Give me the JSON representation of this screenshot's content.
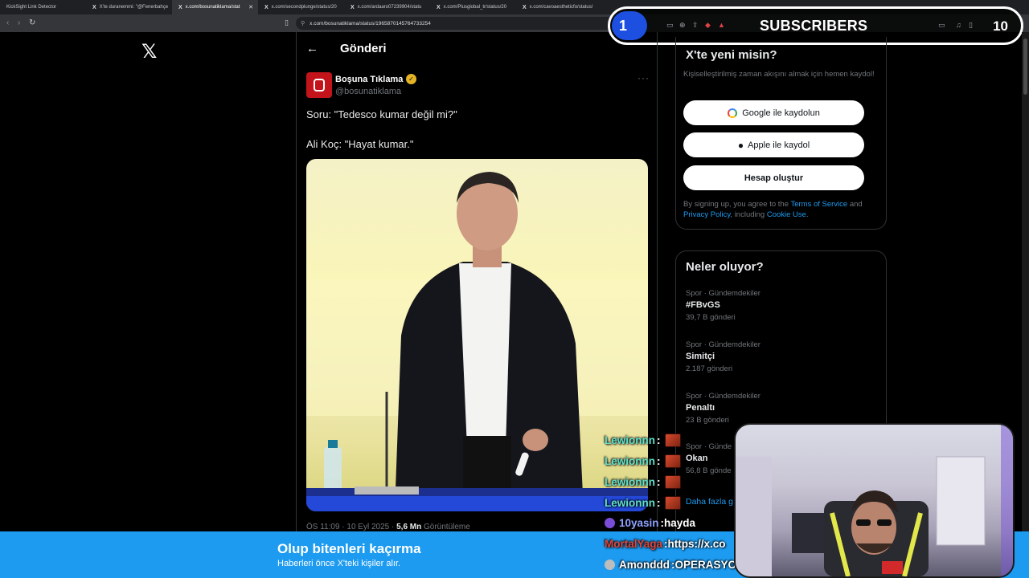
{
  "browser": {
    "tabs": [
      {
        "icon": "",
        "label": "KickSight Link Detector",
        "active": false
      },
      {
        "icon": "X",
        "label": "X'te duranemmi: \"@Fenerbahçe",
        "active": false
      },
      {
        "icon": "X",
        "label": "x.com/bosunatiklama/stat",
        "active": true
      },
      {
        "icon": "X",
        "label": "x.com/secondplunge/status/20",
        "active": false
      },
      {
        "icon": "X",
        "label": "x.com/ardaaro07239904/statu",
        "active": false
      },
      {
        "icon": "X",
        "label": "x.com/Plusglobal_tr/status/20",
        "active": false
      },
      {
        "icon": "X",
        "label": "x.com/cavoaestheticfo/status/",
        "active": false
      }
    ],
    "url": "x.com/bosunatiklama/status/1965870145764733254"
  },
  "overlay": {
    "current": "1",
    "label": "SUBSCRIBERS",
    "goal": "10"
  },
  "post": {
    "header_title": "Gönderi",
    "author_name": "Boşuna Tıklama",
    "author_handle": "@bosunatiklama",
    "text_line1": "Soru: \"Tedesco kumar değil mi?\"",
    "text_line2": "Ali Koç: \"Hayat kumar.\"",
    "meta_time": "ÖS 11:09 · 10 Eyl 2025 · ",
    "meta_views": "5,6 Mn",
    "meta_views_label": " Görüntüleme"
  },
  "signup": {
    "title": "X'te yeni misin?",
    "subtitle": "Kişiselleştirilmiş zaman akışını almak için hemen kaydol!",
    "google_btn": "Google ile kaydolun",
    "apple_btn": "Apple ile kaydol",
    "create_btn": "Hesap oluştur",
    "terms_pre": "By signing up, you agree to the ",
    "terms_tos": "Terms of Service",
    "terms_and": " and ",
    "terms_privacy": "Privacy Policy",
    "terms_including": ", including ",
    "terms_cookie": "Cookie Use",
    "terms_end": "."
  },
  "trends": {
    "title": "Neler oluyor?",
    "items": [
      {
        "category": "Spor · Gündemdekiler",
        "name": "#FBvGS",
        "count": "39,7 B gönderi"
      },
      {
        "category": "Spor · Gündemdekiler",
        "name": "Simitçi",
        "count": "2.187 gönderi"
      },
      {
        "category": "Spor · Gündemdekiler",
        "name": "Penaltı",
        "count": "23 B gönderi"
      },
      {
        "category": "Spor · Günde",
        "name": "Okan",
        "count": "56,8 B gönde"
      }
    ],
    "show_more": "Daha fazla g"
  },
  "banner": {
    "title": "Olup bitenleri kaçırma",
    "subtitle": "Haberleri önce X'teki kişiler alır."
  },
  "chat": [
    {
      "user": "Lewionnn",
      "sep": " :",
      "message": "",
      "user_color": "#5fe0c9",
      "emote": true
    },
    {
      "user": "Lewionnn",
      "sep": " :",
      "message": "",
      "user_color": "#5fe0c9",
      "emote": true
    },
    {
      "user": "Lewionnn",
      "sep": " :",
      "message": "",
      "user_color": "#5fe0c9",
      "emote": true
    },
    {
      "user": "Lewionnn",
      "sep": " :",
      "message": "",
      "user_color": "#5fe0c9",
      "emote": true
    },
    {
      "user": "10yasin",
      "sep": " :",
      "message": " hayda",
      "user_color": "#8fa2ff",
      "badge_color": "#7a4dd8"
    },
    {
      "user": "MortalYaga",
      "sep": " :",
      "message": " https://x.co",
      "user_color": "#e0443a"
    },
    {
      "user": "Amonddd",
      "sep": " :",
      "message": " OPERASYO",
      "user_color": "#ffffff",
      "badge_color": "#bdbdbd"
    }
  ],
  "icons": {
    "x_logo": "𝕏",
    "back": "←",
    "more": "···",
    "verified": "✓",
    "apple": ""
  }
}
